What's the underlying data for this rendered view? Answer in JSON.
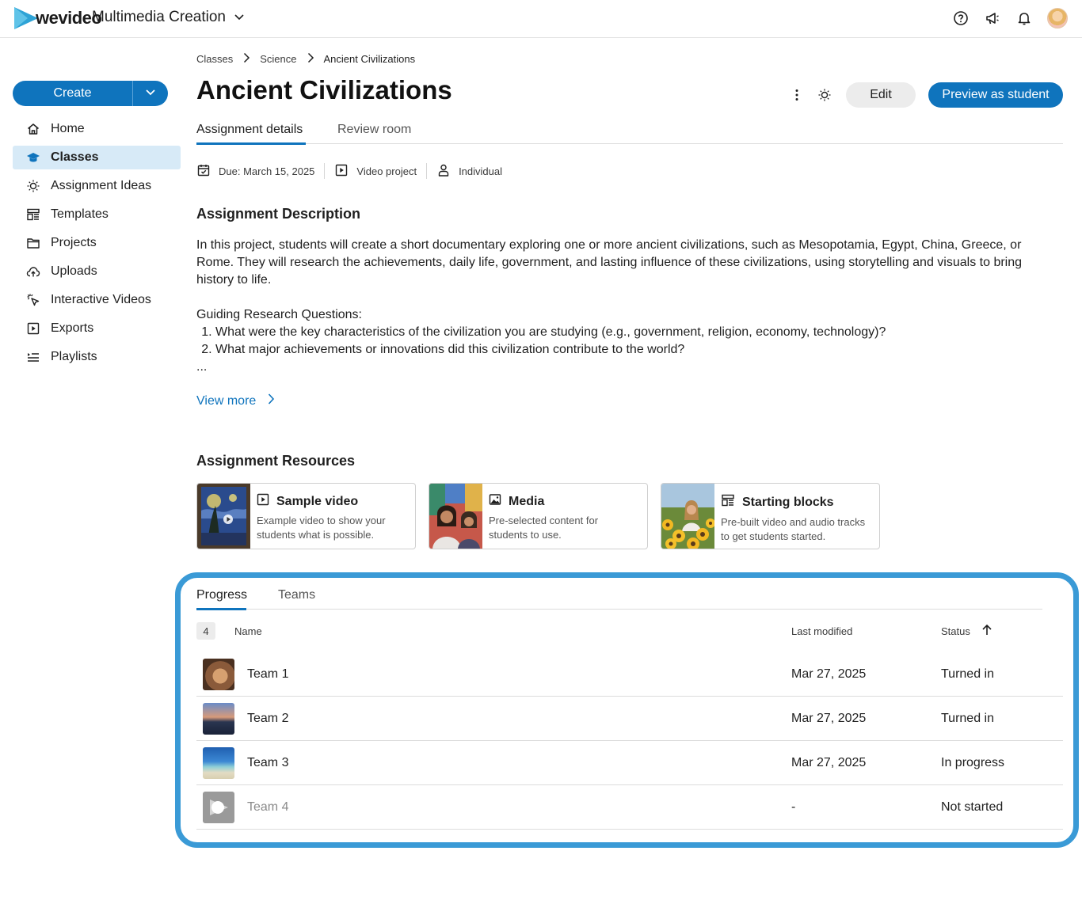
{
  "app": {
    "logo_text": "wevideo",
    "workspace": "Multimedia Creation"
  },
  "sidebar": {
    "create_label": "Create",
    "items": [
      {
        "label": "Home",
        "icon": "home-icon"
      },
      {
        "label": "Classes",
        "icon": "graduation-cap-icon",
        "active": true
      },
      {
        "label": "Assignment Ideas",
        "icon": "lightbulb-icon"
      },
      {
        "label": "Templates",
        "icon": "templates-icon"
      },
      {
        "label": "Projects",
        "icon": "folder-icon"
      },
      {
        "label": "Uploads",
        "icon": "cloud-upload-icon"
      },
      {
        "label": "Interactive Videos",
        "icon": "cursor-click-icon"
      },
      {
        "label": "Exports",
        "icon": "export-play-icon"
      },
      {
        "label": "Playlists",
        "icon": "playlist-icon"
      }
    ]
  },
  "breadcrumb": [
    "Classes",
    "Science",
    "Ancient Civilizations"
  ],
  "page": {
    "title": "Ancient Civilizations",
    "edit_label": "Edit",
    "preview_label": "Preview as student"
  },
  "tabs": {
    "details": "Assignment details",
    "review": "Review room"
  },
  "meta": {
    "due": "Due: March 15, 2025",
    "type": "Video project",
    "mode": "Individual"
  },
  "description": {
    "heading": "Assignment Description",
    "paragraph": "In this project, students will create a short documentary exploring one or more ancient civilizations, such as Mesopotamia, Egypt, China, Greece, or Rome. They will research the achievements, daily life, government, and lasting influence of these civilizations, using storytelling and visuals to bring history to life.",
    "questions_heading": "Guiding Research Questions:",
    "questions": [
      "What were the key characteristics of the civilization you are studying (e.g., government, religion, economy, technology)?",
      "What major achievements or innovations did this civilization contribute to the world?"
    ],
    "ellipsis": "...",
    "view_more": "View more"
  },
  "resources": {
    "heading": "Assignment Resources",
    "cards": [
      {
        "title": "Sample video",
        "desc": "Example video to show your students what is possible."
      },
      {
        "title": "Media",
        "desc": "Pre-selected content for students to use."
      },
      {
        "title": "Starting blocks",
        "desc": "Pre-built video and audio tracks to get students started."
      }
    ]
  },
  "progress": {
    "tab_progress": "Progress",
    "tab_teams": "Teams",
    "count": "4",
    "col_name": "Name",
    "col_modified": "Last modified",
    "col_status": "Status",
    "rows": [
      {
        "name": "Team 1",
        "modified": "Mar 27, 2025",
        "status": "Turned in"
      },
      {
        "name": "Team 2",
        "modified": "Mar 27, 2025",
        "status": "Turned in"
      },
      {
        "name": "Team 3",
        "modified": "Mar 27, 2025",
        "status": "In progress"
      },
      {
        "name": "Team 4",
        "modified": "-",
        "status": "Not started"
      }
    ]
  },
  "colors": {
    "accent": "#0f74bd",
    "highlight_border": "#3a9ad6",
    "nav_active_bg": "#d7eaf7"
  }
}
